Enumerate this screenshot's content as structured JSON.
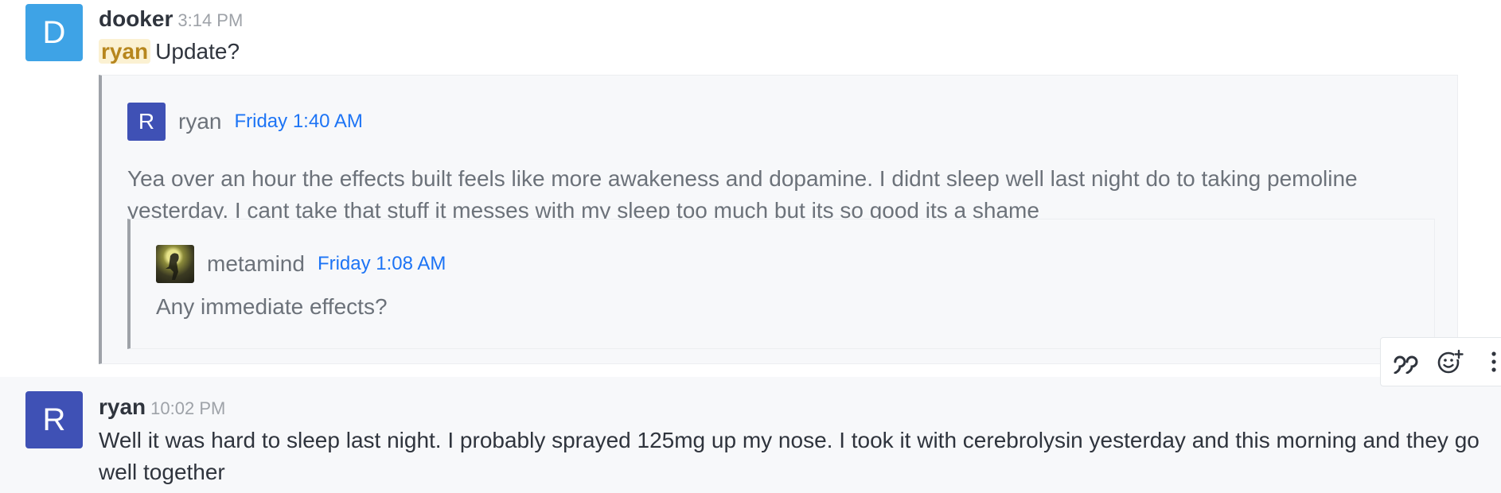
{
  "messages": [
    {
      "avatar_letter": "D",
      "username": "dooker",
      "time": "3:14 PM",
      "mention": "ryan",
      "text": "Update?",
      "quote": {
        "avatar_letter": "R",
        "username": "ryan",
        "time": "Friday 1:40 AM",
        "text": "Yea over an hour the effects built feels like more awakeness and dopamine. I didnt sleep well last night do to taking pemoline yesterday. I cant take that stuff it messes with my sleep too much but its so good its a shame",
        "quote": {
          "username": "metamind",
          "time": "Friday 1:08 AM",
          "text": "Any immediate effects?"
        }
      }
    },
    {
      "avatar_letter": "R",
      "username": "ryan",
      "time": "10:02 PM",
      "text": "Well it was hard to sleep last night. I probably sprayed 125mg up my nose. I took it with cerebrolysin yesterday and this morning and they go well together"
    }
  ],
  "toolbar": {
    "icons": [
      "quote-icon",
      "add-reaction-icon",
      "kebab-menu-icon"
    ]
  },
  "colors": {
    "dooker_avatar": "#3ea3e6",
    "ryan_avatar": "#3f51b5",
    "mention_bg": "#fbf1d2",
    "mention_text": "#b7861d",
    "link_time": "#1d74f5"
  }
}
